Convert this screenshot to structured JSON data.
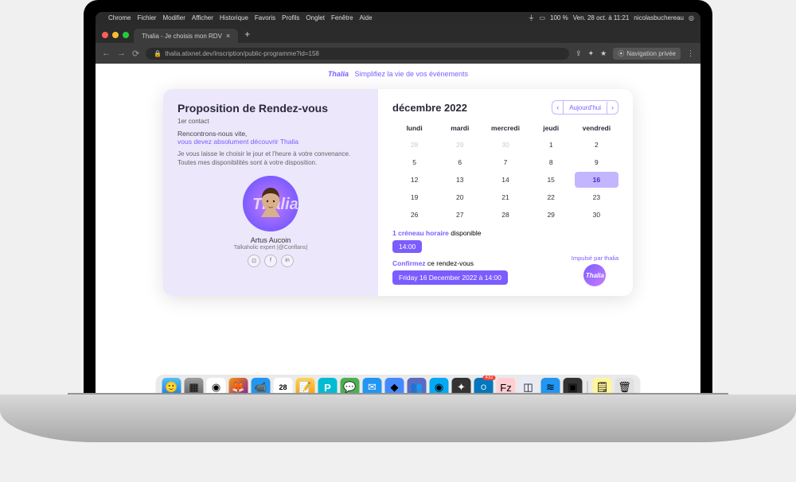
{
  "macos": {
    "app": "Chrome",
    "menus": [
      "Fichier",
      "Modifier",
      "Afficher",
      "Historique",
      "Favoris",
      "Profils",
      "Onglet",
      "Fenêtre",
      "Aide"
    ],
    "battery": "100 %",
    "datetime": "Ven. 28 oct. à 11:21",
    "user": "nicolasbuchereau"
  },
  "browser": {
    "tab_title": "Thalia - Je choisis mon RDV",
    "url": "thalia.atixnet.dev/inscription/public-programme?id=158",
    "private_label": "Navigation privée"
  },
  "header": {
    "brand": "Thalia",
    "tagline": "Simplifiez la vie de vos événements"
  },
  "card": {
    "title": "Proposition de Rendez-vous",
    "sub": "1er contact",
    "intro1": "Rencontrons-nous vite,",
    "intro2": "vous devez absolument découvrir Thalia",
    "intro3": "Je vous laisse le choisir le jour et l'heure à votre convenance. Toutes mes disponibilités sont à votre disposition.",
    "person_name": "Artus Aucoin",
    "person_role": "Talkaholic expert |@Conflans|"
  },
  "calendar": {
    "month": "décembre 2022",
    "today_label": "Aujourd'hui",
    "dow": [
      "lundi",
      "mardi",
      "mercredi",
      "jeudi",
      "vendredi"
    ],
    "days": [
      {
        "d": "28",
        "other": true
      },
      {
        "d": "29",
        "other": true
      },
      {
        "d": "30",
        "other": true
      },
      {
        "d": "1"
      },
      {
        "d": "2"
      },
      {
        "d": "5"
      },
      {
        "d": "6"
      },
      {
        "d": "7"
      },
      {
        "d": "8"
      },
      {
        "d": "9"
      },
      {
        "d": "12"
      },
      {
        "d": "13"
      },
      {
        "d": "14"
      },
      {
        "d": "15"
      },
      {
        "d": "16",
        "selected": true
      },
      {
        "d": "19"
      },
      {
        "d": "20"
      },
      {
        "d": "21"
      },
      {
        "d": "22"
      },
      {
        "d": "23"
      },
      {
        "d": "26"
      },
      {
        "d": "27"
      },
      {
        "d": "28"
      },
      {
        "d": "29"
      },
      {
        "d": "30"
      }
    ],
    "slot_prefix": "1 créneau horaire",
    "slot_suffix": " disponible",
    "time": "14:00",
    "confirm_prefix": "Confirmez",
    "confirm_suffix": " ce rendez-vous",
    "confirm_button": "Friday 16 December 2022 à 14:00",
    "powered": "Impulsé par thalia"
  },
  "dock": {
    "cal_day": "28",
    "outlook_badge": "432"
  }
}
